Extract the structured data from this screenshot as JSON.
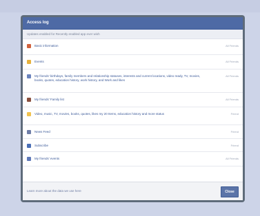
{
  "dialog": {
    "title": "Access log",
    "subtitle": "Updates enabled for Recently enabled app ever wish",
    "close_label": "Close",
    "footer_link": "Learn more about the data we use here"
  },
  "rows": [
    {
      "label": "Basic information",
      "right": "All Friends",
      "icon_color": "#d0623e"
    },
    {
      "label": "Events",
      "right": "All Friends",
      "icon_color": "#e7b23d"
    },
    {
      "label": "My friends' birthdays, family members and relationship statuses, interests and current locations, video ready, TV, movies, books, quotes, education history, work history, and Work and likes",
      "right": "All Friends",
      "icon_color": "#6b84bd"
    },
    {
      "label": "My friends' Family list",
      "right": "All Friends",
      "icon_color": "#8a4f3d"
    },
    {
      "label": "Video, music, TV, movies, books, quotes, likes my 20 Items, education history and more status",
      "right": "Friend",
      "icon_color": "#f1c24f"
    },
    {
      "label": "News Feed",
      "right": "Friend",
      "icon_color": "#6f7ea8"
    },
    {
      "label": "Subscribe",
      "right": "Friend",
      "icon_color": "#4a6fb6"
    },
    {
      "label": "My friends' events",
      "right": "All Friends",
      "icon_color": "#5f79b9"
    }
  ]
}
